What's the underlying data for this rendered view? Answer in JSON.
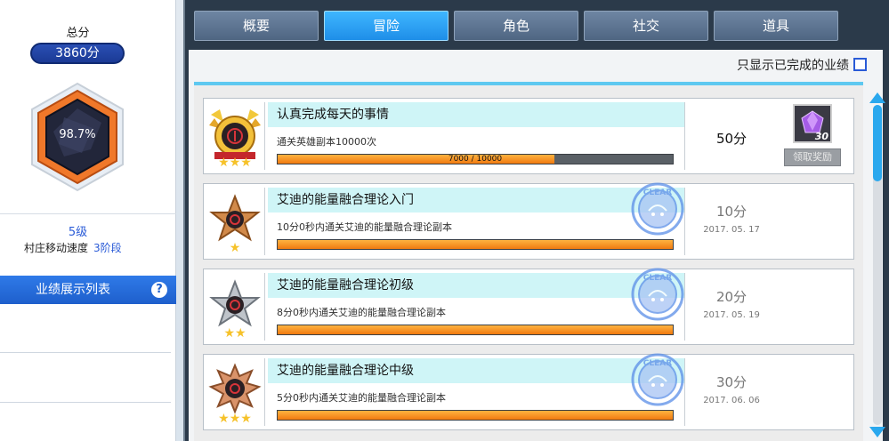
{
  "profile": {
    "total_label": "总分",
    "total_score": "3860分",
    "completion": "98.7%",
    "level": "5级",
    "speed_label": "村庄移动速度",
    "speed_value": "3阶段",
    "list_header": "业绩展示列表",
    "help_symbol": "?"
  },
  "tabs": [
    {
      "label": "概要",
      "active": false
    },
    {
      "label": "冒险",
      "active": true
    },
    {
      "label": "角色",
      "active": false
    },
    {
      "label": "社交",
      "active": false
    },
    {
      "label": "道具",
      "active": false
    }
  ],
  "filter": {
    "label": "只显示已完成的业绩",
    "checked": false
  },
  "achievements": [
    {
      "title": "认真完成每天的事情",
      "description": "通关英雄副本10000次",
      "progress_text": "7000 / 10000",
      "progress": 0.7,
      "points": "50分",
      "completed": false,
      "reward_count": "30",
      "claim_label": "领取奖励",
      "medal": "gold"
    },
    {
      "title": "艾迪的能量融合理论入门",
      "description": "10分0秒内通关艾迪的能量融合理论副本",
      "progress": 1.0,
      "points": "10分",
      "date": "2017. 05. 17",
      "completed": true,
      "stamp": "CLEAR",
      "medal": "bronze"
    },
    {
      "title": "艾迪的能量融合理论初级",
      "description": "8分0秒内通关艾迪的能量融合理论副本",
      "progress": 1.0,
      "points": "20分",
      "date": "2017. 05. 19",
      "completed": true,
      "stamp": "CLEAR",
      "medal": "silver"
    },
    {
      "title": "艾迪的能量融合理论中级",
      "description": "5分0秒内通关艾迪的能量融合理论副本",
      "progress": 1.0,
      "points": "30分",
      "date": "2017. 06. 06",
      "completed": true,
      "stamp": "CLEAR",
      "medal": "copper"
    }
  ],
  "colors": {
    "accent_blue": "#2a5bd7",
    "tab_active": "#1e8ee8",
    "progress_orange": "#f07a10",
    "title_bar": "#cff5f7"
  }
}
